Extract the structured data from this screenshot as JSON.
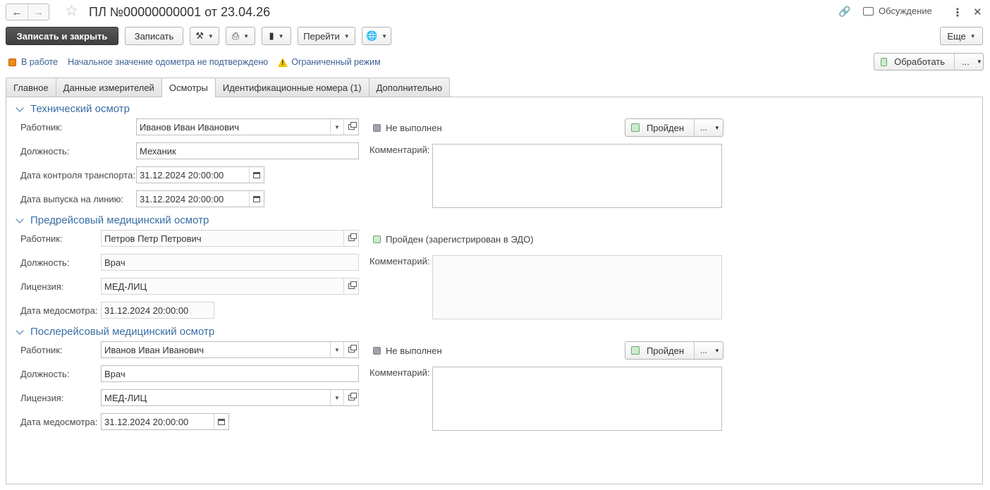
{
  "title_bar": {
    "back_icon": "arrow-left-icon",
    "forward_icon": "arrow-right-icon",
    "favorite_icon": "star-icon",
    "title": "ПЛ №00000000001 от 23.04.26",
    "discussion_label": "Обсуждение"
  },
  "toolbar": {
    "save_close": "Записать и закрыть",
    "save": "Записать",
    "goto": "Перейти",
    "more": "Еще"
  },
  "status": {
    "state": "В работе",
    "odometer_note": "Начальное значение одометра не подтверждено",
    "mode": "Ограниченный режим",
    "process_button": "Обработать",
    "process_more": "..."
  },
  "tabs": [
    {
      "label": "Главное"
    },
    {
      "label": "Данные измерителей"
    },
    {
      "label": "Осмотры"
    },
    {
      "label": "Идентификационные номера (1)"
    },
    {
      "label": "Дополнительно"
    }
  ],
  "tech": {
    "heading": "Технический осмотр",
    "worker_label": "Работник:",
    "worker": "Иванов Иван Иванович",
    "position_label": "Должность:",
    "position": "Механик",
    "control_date_label": "Дата контроля транспорта:",
    "control_date": "31.12.2024 20:00:00",
    "release_date_label": "Дата выпуска на линию:",
    "release_date": "31.12.2024 20:00:00",
    "status": "Не выполнен",
    "pass_button": "Пройден",
    "pass_more": "...",
    "comment_label": "Комментарий:"
  },
  "pre_med": {
    "heading": "Предрейсовый медицинский осмотр",
    "worker_label": "Работник:",
    "worker": "Петров Петр Петрович",
    "position_label": "Должность:",
    "position": "Врач",
    "license_label": "Лицензия:",
    "license": "МЕД-ЛИЦ",
    "date_label": "Дата медосмотра:",
    "date": "31.12.2024 20:00:00",
    "status": "Пройден (зарегистрирован в ЭДО)",
    "comment_label": "Комментарий:"
  },
  "post_med": {
    "heading": "Послерейсовый медицинский осмотр",
    "worker_label": "Работник:",
    "worker": "Иванов Иван Иванович",
    "position_label": "Должность:",
    "position": "Врач",
    "license_label": "Лицензия:",
    "license": "МЕД-ЛИЦ",
    "date_label": "Дата медосмотра:",
    "date": "31.12.2024 20:00:00",
    "status": "Не выполнен",
    "pass_button": "Пройден",
    "pass_more": "...",
    "comment_label": "Комментарий:"
  }
}
